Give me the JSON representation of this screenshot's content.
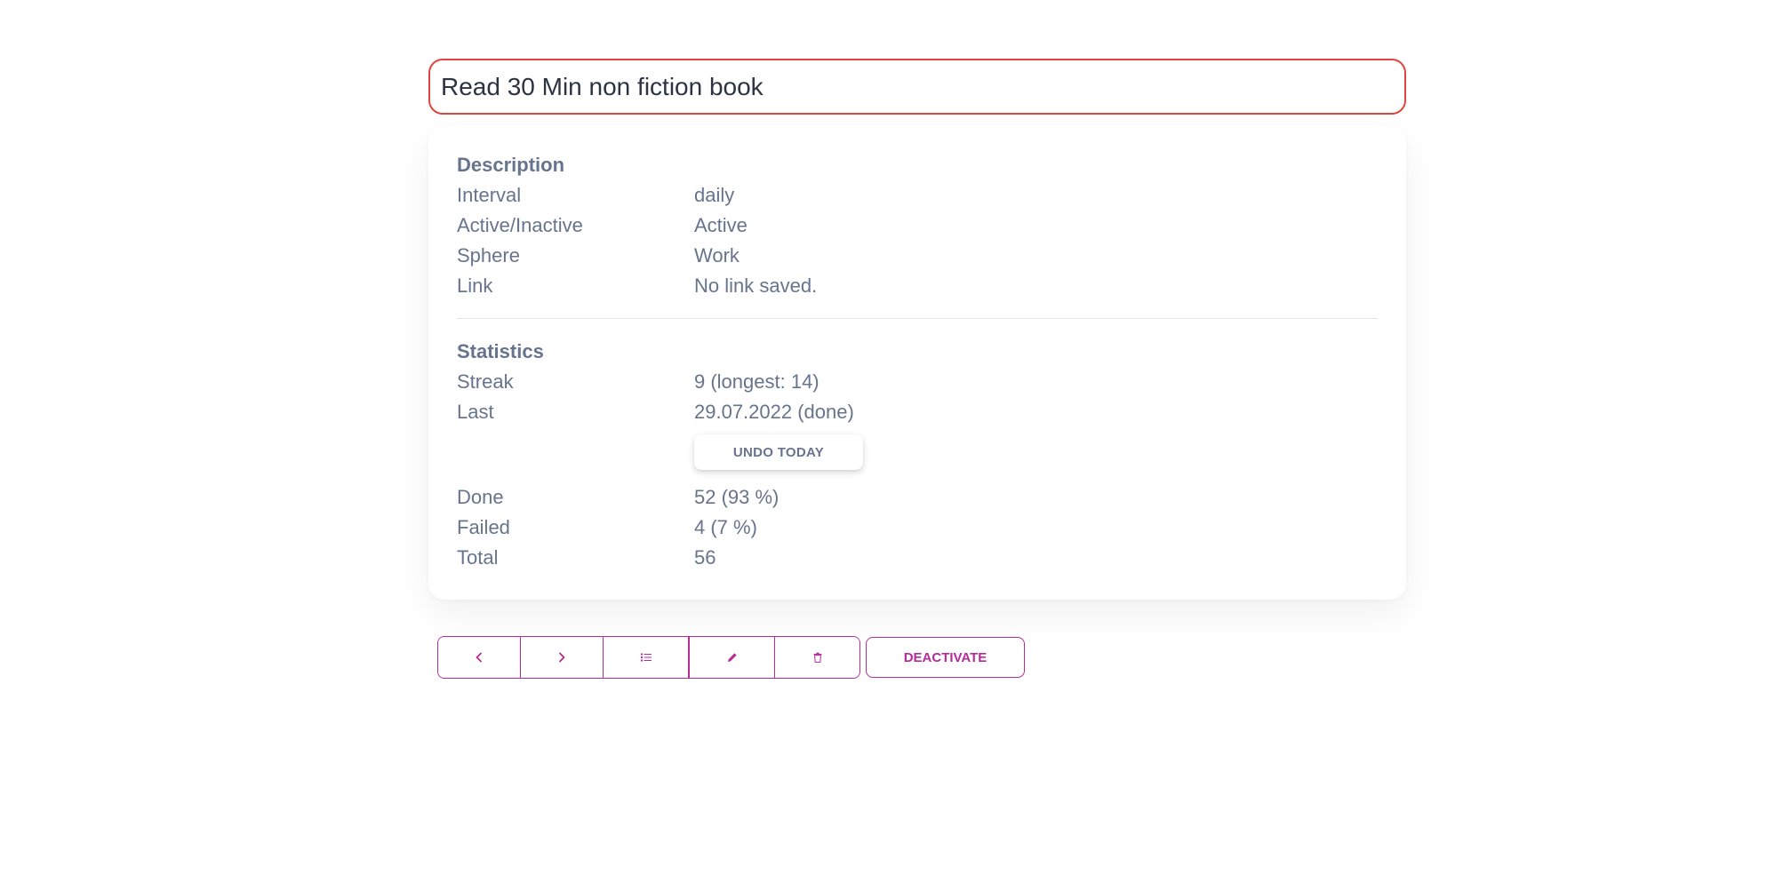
{
  "habit": {
    "title": "Read 30 Min non fiction book"
  },
  "description": {
    "heading": "Description",
    "rows": [
      {
        "label": "Interval",
        "value": "daily"
      },
      {
        "label": "Active/Inactive",
        "value": "Active"
      },
      {
        "label": "Sphere",
        "value": "Work"
      },
      {
        "label": "Link",
        "value": "No link saved."
      }
    ]
  },
  "statistics": {
    "heading": "Statistics",
    "streak": {
      "label": "Streak",
      "value": "9 (longest: 14)"
    },
    "last": {
      "label": "Last",
      "value": "29.07.2022 (done)"
    },
    "undo_label": "UNDO TODAY",
    "done": {
      "label": "Done",
      "value": "52 (93 %)"
    },
    "failed": {
      "label": "Failed",
      "value": "4 (7 %)"
    },
    "total": {
      "label": "Total",
      "value": "56"
    }
  },
  "toolbar": {
    "icons": [
      "chevron-left-icon",
      "chevron-right-icon",
      "list-icon",
      "pencil-icon",
      "trash-icon"
    ],
    "deactivate_label": "DEACTIVATE"
  },
  "colors": {
    "accent": "#b52b98",
    "title_border": "#e0453d",
    "text": "#67748e"
  }
}
